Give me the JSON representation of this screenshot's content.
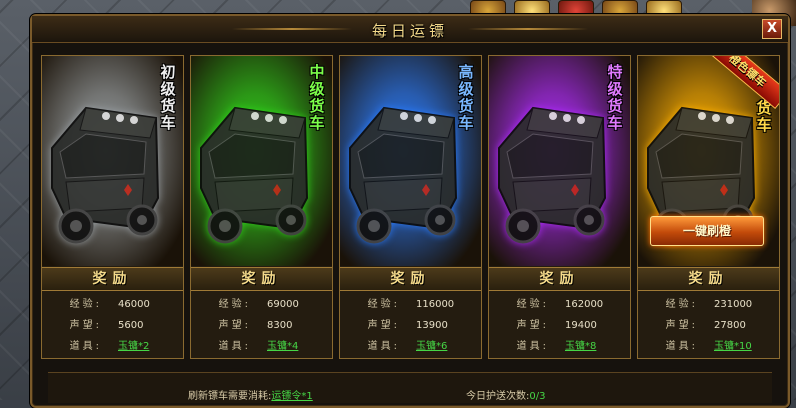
{
  "window": {
    "title": "每日运镖",
    "close_label": "X"
  },
  "labels": {
    "reward_header": "奖励",
    "exp": "经验:",
    "fame": "声望:",
    "item": "道具:"
  },
  "cards": [
    {
      "vehicle": "初级货车",
      "exp": "46000",
      "fame": "5600",
      "item": "玉镛*2",
      "label_color": "#f0f0f0",
      "theme": "#9aa0a4"
    },
    {
      "vehicle": "中级货车",
      "exp": "69000",
      "fame": "8300",
      "item": "玉镛*4",
      "label_color": "#7cff4a",
      "theme": "#2fd41a"
    },
    {
      "vehicle": "高级货车",
      "exp": "116000",
      "fame": "13900",
      "item": "玉镛*6",
      "label_color": "#7ab8ff",
      "theme": "#2a7cff"
    },
    {
      "vehicle": "特级货车",
      "exp": "162000",
      "fame": "19400",
      "item": "玉镛*8",
      "label_color": "#e07aff",
      "theme": "#b02aff"
    },
    {
      "vehicle": "橙色镖车",
      "exp": "231000",
      "fame": "27800",
      "item": "玉镛*10",
      "label_color": "#ffd94a",
      "theme": "#ffb000",
      "badge": "橙色镖车",
      "button": "一键刷橙"
    }
  ],
  "footer": {
    "refresh_cost_label": "刷新镖车需要消耗:",
    "refresh_cost_item": "运镖令*1",
    "escort_count_label": "今日护送次数:",
    "escort_count_value": "0/3"
  }
}
